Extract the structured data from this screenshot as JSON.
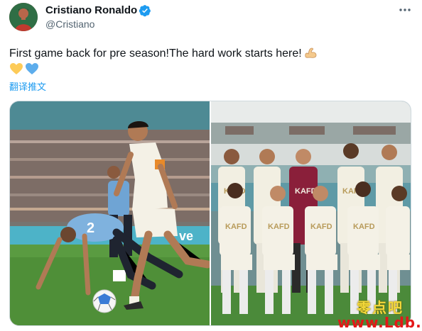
{
  "author": {
    "name": "Cristiano Ronaldo",
    "handle": "@Cristiano",
    "verified": true,
    "avatar_icon": "profile-photo"
  },
  "tweet": {
    "text": "First game back for pre season!The hard work starts here!",
    "emojis": [
      "flexed-biceps",
      "yellow-heart",
      "blue-heart"
    ],
    "translate_label": "翻译推文"
  },
  "media": {
    "left_photo": {
      "ad_board_text": "ve",
      "shirt_number": "2"
    },
    "right_photo": {
      "sponsor": "KAFD"
    }
  },
  "watermark": {
    "chinese": "零点吧",
    "url": "www.Ldb.cc"
  },
  "colors": {
    "accent": "#1d9bf0",
    "text_primary": "#0f1419",
    "text_secondary": "#536471",
    "watermark_yellow": "#f4d93a",
    "watermark_red": "#e31818"
  }
}
